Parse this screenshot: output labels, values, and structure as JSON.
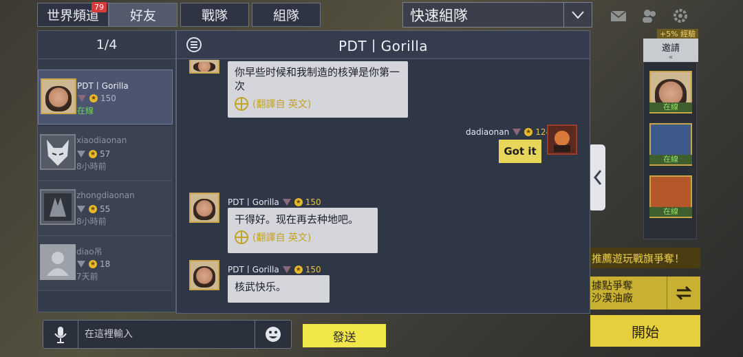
{
  "tabs": [
    {
      "label": "世界頻道",
      "badge": "79",
      "active": false
    },
    {
      "label": "好友",
      "active": true
    },
    {
      "label": "戰隊",
      "active": false
    },
    {
      "label": "組隊",
      "active": false
    }
  ],
  "quick_team": {
    "label": "快速組隊"
  },
  "left_panel": {
    "counter": "1/4",
    "friends": [
      {
        "name": "PDT丨Gorilla",
        "level": "150",
        "status": "在線"
      },
      {
        "name": "xiaodiaonan",
        "level": "57",
        "status": "8小時前"
      },
      {
        "name": "zhongdiaonan",
        "level": "55",
        "status": "8小時前"
      },
      {
        "name": "diao吊",
        "level": "18",
        "status": "7天前"
      }
    ]
  },
  "chat": {
    "title": "PDT丨Gorilla",
    "msg1": {
      "text": "你早些时候和我制造的核弹是你第一次",
      "translate": "(翻譯自 英文)"
    },
    "msg2": {
      "sender": "dadiaonan",
      "level": "124",
      "text": "Got it"
    },
    "msg3": {
      "sender": "PDT丨Gorilla",
      "level": "150",
      "text": "干得好。现在再去种地吧。",
      "translate": "(翻譯自 英文)"
    },
    "msg4": {
      "sender": "PDT丨Gorilla",
      "level": "150",
      "text": "核武快乐。"
    }
  },
  "input": {
    "placeholder": "在這裡輸入",
    "send_label": "發送"
  },
  "right": {
    "boost": "+5% 經驗",
    "invite_label": "邀請",
    "statuses": [
      "在線",
      "在線",
      "在線"
    ],
    "promo": "推薦遊玩戰旗爭奪！",
    "mode_line1": "據點爭奪",
    "mode_line2": "沙漠油廠",
    "start_label": "開始"
  },
  "colors": {
    "accent_yellow": "#f2e74a",
    "online_green": "#69d64f",
    "level_gold": "#e9c24a"
  }
}
